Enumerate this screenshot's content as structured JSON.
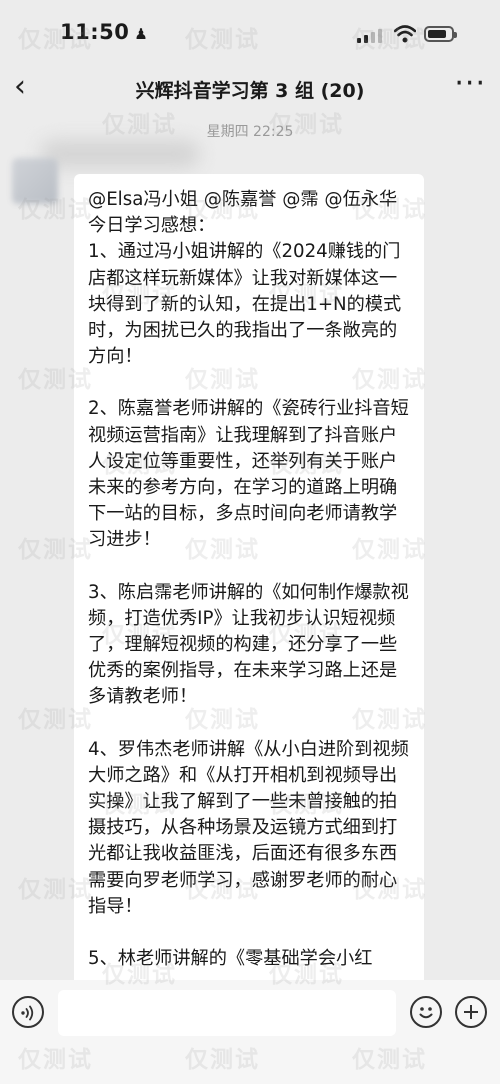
{
  "status": {
    "time": "11:50",
    "person_glyph": "♟"
  },
  "nav": {
    "back_glyph": "‹",
    "title": "兴辉抖音学习第 3 组 (20)",
    "more_glyph": "···"
  },
  "chat": {
    "timestamp": "星期四 22:25",
    "message": {
      "paragraphs": [
        "@Elsa冯小姐 @陈嘉誉 @霈 @伍永华 今日学习感想：\n1、通过冯小姐讲解的《2024赚钱的门店都这样玩新媒体》让我对新媒体这一块得到了新的认知，在提出1+N的模式时，为困扰已久的我指出了一条敞亮的方向！",
        "2、陈嘉誉老师讲解的《瓷砖行业抖音短视频运营指南》让我理解到了抖音账户人设定位等重要性，还举列有关于账户未来的参考方向，在学习的道路上明确下一站的目标，多点时间向老师请教学习进步！",
        "3、陈启霈老师讲解的《如何制作爆款视频，打造优秀IP》让我初步认识短视频了，理解短视频的构建，还分享了一些优秀的案例指导，在未来学习路上还是多请教老师！",
        "4、罗伟杰老师讲解《从小白进阶到视频大师之路》和《从打开相机到视频导出实操》让我了解到了一些未曾接触的拍摄技巧，从各种场景及运镜方式细到打光都让我收益匪浅，后面还有很多东西需要向罗老师学习，感谢罗老师的耐心指导！",
        "5、林老师讲解的《零基础学会小红"
      ]
    }
  },
  "watermark": {
    "text": "仅测试",
    "color": "#969696"
  }
}
